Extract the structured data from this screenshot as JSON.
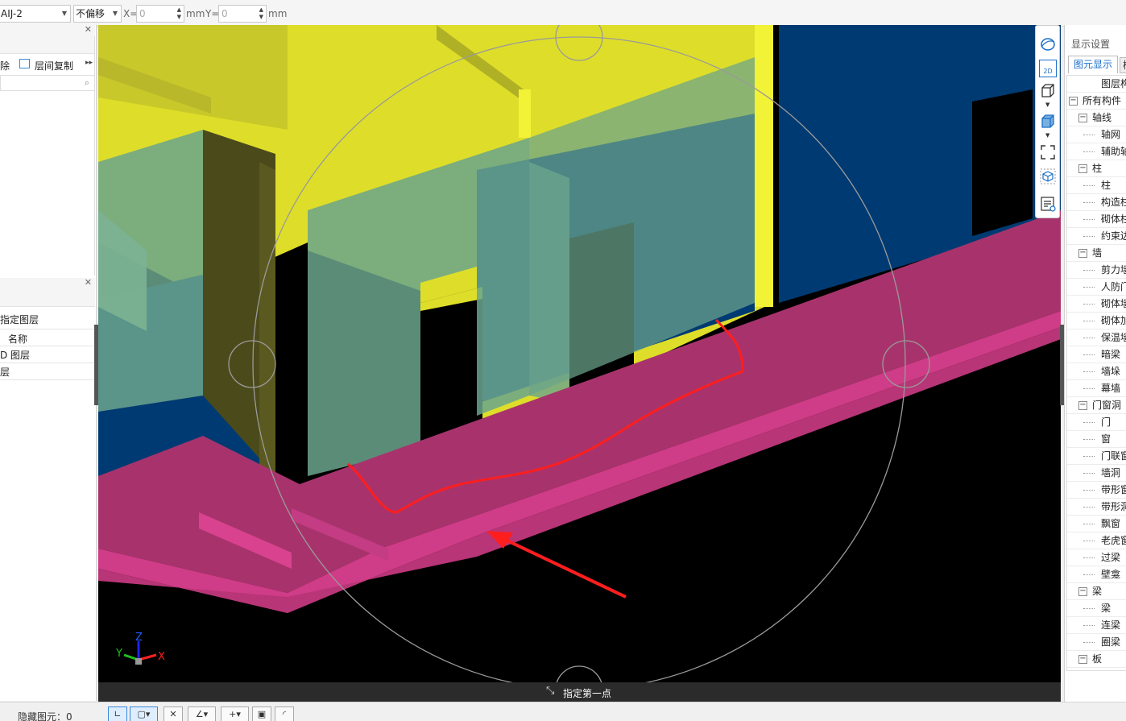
{
  "toolbar": {
    "layer_select": "AIJ-2",
    "offset_select": "不偏移",
    "x_label": "X=",
    "x_value": "0",
    "y_label": "Y=",
    "y_value": "0",
    "unit": "mm"
  },
  "left_panel": {
    "actions": {
      "delete": "除",
      "copy_between_floors": "层间复制"
    },
    "layers": {
      "assign_layer": "指定图层",
      "column_name": "名称",
      "row1": "D 图层",
      "row2": "层"
    }
  },
  "viewport": {
    "prompt": "指定第一点",
    "axis_labels": {
      "x": "X",
      "y": "Y",
      "z": "Z"
    }
  },
  "view_tools": {
    "icons": [
      "orbit-icon",
      "2d-view-icon",
      "3d-box-icon",
      "3d-box-solid-icon",
      "fullscreen-icon",
      "isometric-cube-icon",
      "display-list-icon"
    ],
    "view_2d_label": "2D"
  },
  "right_panel": {
    "title": "显示设置",
    "tab_element": "图元显示",
    "tab_other": "楼",
    "tree": [
      {
        "label": "图层构",
        "level": 0,
        "toggle": ""
      },
      {
        "label": "所有构件",
        "level": 0,
        "toggle": "−"
      },
      {
        "label": "轴线",
        "level": 1,
        "toggle": "−"
      },
      {
        "label": "轴网",
        "level": 2,
        "toggle": ""
      },
      {
        "label": "辅助轴",
        "level": 2,
        "toggle": ""
      },
      {
        "label": "柱",
        "level": 1,
        "toggle": "−"
      },
      {
        "label": "柱",
        "level": 2,
        "toggle": ""
      },
      {
        "label": "构造柱",
        "level": 2,
        "toggle": ""
      },
      {
        "label": "砌体柱",
        "level": 2,
        "toggle": ""
      },
      {
        "label": "约束边",
        "level": 2,
        "toggle": ""
      },
      {
        "label": "墙",
        "level": 1,
        "toggle": "−"
      },
      {
        "label": "剪力墙",
        "level": 2,
        "toggle": ""
      },
      {
        "label": "人防门",
        "level": 2,
        "toggle": ""
      },
      {
        "label": "砌体墙",
        "level": 2,
        "toggle": ""
      },
      {
        "label": "砌体加",
        "level": 2,
        "toggle": ""
      },
      {
        "label": "保温墙",
        "level": 2,
        "toggle": ""
      },
      {
        "label": "暗梁",
        "level": 2,
        "toggle": ""
      },
      {
        "label": "墙垛",
        "level": 2,
        "toggle": ""
      },
      {
        "label": "幕墙",
        "level": 2,
        "toggle": ""
      },
      {
        "label": "门窗洞",
        "level": 1,
        "toggle": "−"
      },
      {
        "label": "门",
        "level": 2,
        "toggle": ""
      },
      {
        "label": "窗",
        "level": 2,
        "toggle": ""
      },
      {
        "label": "门联窗",
        "level": 2,
        "toggle": ""
      },
      {
        "label": "墙洞",
        "level": 2,
        "toggle": ""
      },
      {
        "label": "带形窗",
        "level": 2,
        "toggle": ""
      },
      {
        "label": "带形洞",
        "level": 2,
        "toggle": ""
      },
      {
        "label": "飘窗",
        "level": 2,
        "toggle": ""
      },
      {
        "label": "老虎窗",
        "level": 2,
        "toggle": ""
      },
      {
        "label": "过梁",
        "level": 2,
        "toggle": ""
      },
      {
        "label": "壁龛",
        "level": 2,
        "toggle": ""
      },
      {
        "label": "梁",
        "level": 1,
        "toggle": "−"
      },
      {
        "label": "梁",
        "level": 2,
        "toggle": ""
      },
      {
        "label": "连梁",
        "level": 2,
        "toggle": ""
      },
      {
        "label": "圈梁",
        "level": 2,
        "toggle": ""
      },
      {
        "label": "板",
        "level": 1,
        "toggle": "−"
      }
    ]
  },
  "status_bar": {
    "hidden_elements": "隐藏图元：0"
  },
  "colors": {
    "wall_yellow": "#dede2a",
    "wall_blue": "#003a72",
    "slab_magenta": "#a8336c",
    "glass_green": "#6ba48c",
    "annotation_red": "#ff1e1e",
    "accent_blue": "#1a6fc9"
  }
}
